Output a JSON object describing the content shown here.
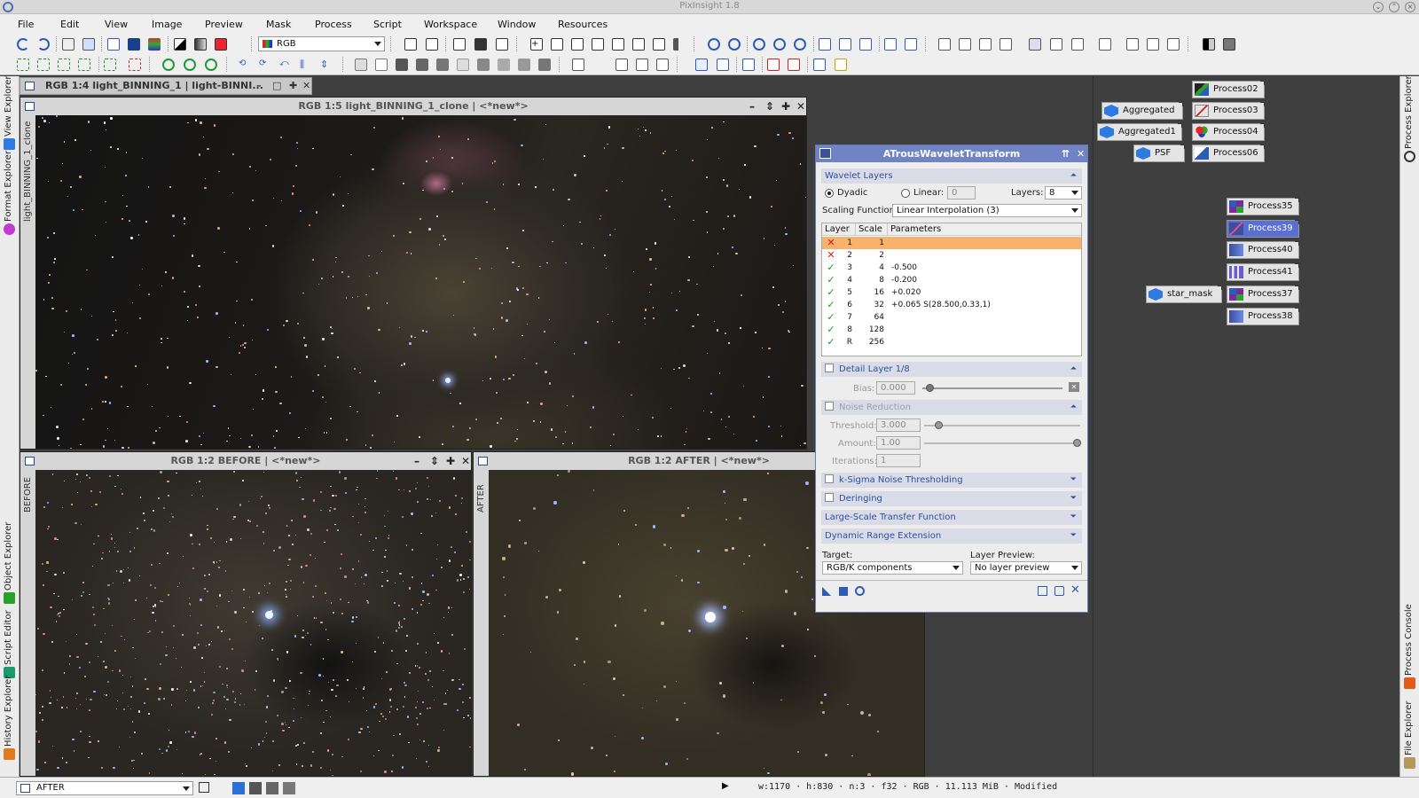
{
  "app": {
    "title": "PixInsight 1.8"
  },
  "menu": [
    "File",
    "Edit",
    "View",
    "Image",
    "Preview",
    "Mask",
    "Process",
    "Script",
    "Workspace",
    "Window",
    "Resources"
  ],
  "toolbar": {
    "channel_select": "RGB"
  },
  "left_tabs": [
    "View Explorer",
    "Format Explorer",
    "Object Explorer",
    "Script Editor",
    "History Explorer"
  ],
  "right_tabs": [
    "Process Explorer",
    "Process Console",
    "File Explorer"
  ],
  "windows": {
    "minimized": {
      "title": "RGB 1:4 light_BINNING_1 | light-BINNI..."
    },
    "clone": {
      "title": "RGB 1:5 light_BINNING_1_clone | <*new*>",
      "side_label": "light_BINNING_1_clone"
    },
    "before": {
      "title": "RGB 1:2 BEFORE | <*new*>",
      "side_label": "BEFORE"
    },
    "after": {
      "title": "RGB 1:2 AFTER | <*new*>",
      "side_label": "AFTER"
    }
  },
  "atw": {
    "title": "ATrousWaveletTransform",
    "wavelet_layers": "Wavelet Layers",
    "dyadic": "Dyadic",
    "linear": "Linear:",
    "linear_value": "0",
    "layers_label": "Layers:",
    "layers_value": "8",
    "scaling_label": "Scaling Function:",
    "scaling_value": "Linear Interpolation (3)",
    "table_headers": [
      "Layer",
      "Scale",
      "Parameters"
    ],
    "rows": [
      {
        "mark": "x",
        "layer": "1",
        "scale": "1",
        "params": ""
      },
      {
        "mark": "x",
        "layer": "2",
        "scale": "2",
        "params": ""
      },
      {
        "mark": "v",
        "layer": "3",
        "scale": "4",
        "params": "-0.500"
      },
      {
        "mark": "v",
        "layer": "4",
        "scale": "8",
        "params": "-0.200"
      },
      {
        "mark": "v",
        "layer": "5",
        "scale": "16",
        "params": "+0.020"
      },
      {
        "mark": "v",
        "layer": "6",
        "scale": "32",
        "params": "+0.065 S(28.500,0.33,1)"
      },
      {
        "mark": "v",
        "layer": "7",
        "scale": "64",
        "params": ""
      },
      {
        "mark": "v",
        "layer": "8",
        "scale": "128",
        "params": ""
      },
      {
        "mark": "v",
        "layer": "R",
        "scale": "256",
        "params": ""
      }
    ],
    "detail_layer": "Detail Layer 1/8",
    "bias_label": "Bias:",
    "bias_value": "0.000",
    "noise_reduction": "Noise Reduction",
    "threshold_label": "Threshold:",
    "threshold_value": "3.000",
    "amount_label": "Amount:",
    "amount_value": "1.00",
    "iterations_label": "Iterations:",
    "iterations_value": "1",
    "ksigma": "k-Sigma Noise Thresholding",
    "deringing": "Deringing",
    "lstf": "Large-Scale Transfer Function",
    "dre": "Dynamic Range Extension",
    "target_label": "Target:",
    "target_value": "RGB/K components",
    "layer_preview_label": "Layer Preview:",
    "layer_preview_value": "No layer preview"
  },
  "process_icons": [
    {
      "name": "Process02",
      "icon": "histogram"
    },
    {
      "name": "Aggregated",
      "icon": "cube"
    },
    {
      "name": "Process03",
      "icon": "curves"
    },
    {
      "name": "Aggregated1",
      "icon": "cube"
    },
    {
      "name": "Process04",
      "icon": "rgb"
    },
    {
      "name": "PSF",
      "icon": "cube"
    },
    {
      "name": "Process06",
      "icon": "mtf"
    },
    {
      "name": "Process35",
      "icon": "grid"
    },
    {
      "name": "Process39",
      "icon": "selected"
    },
    {
      "name": "Process40",
      "icon": "wave"
    },
    {
      "name": "Process41",
      "icon": "bars"
    },
    {
      "name": "star_mask",
      "icon": "cube"
    },
    {
      "name": "Process37",
      "icon": "grid"
    },
    {
      "name": "Process38",
      "icon": "wave"
    }
  ],
  "status": {
    "view_select": "AFTER",
    "info": "w:1170 · h:830 · n:3 · f32 · RGB · 11.113 MiB · Modified"
  },
  "colors": {
    "accent": "#7083c4",
    "selected_row": "#f7b26b",
    "check": "#1c9a1c",
    "cross": "#d01818"
  }
}
